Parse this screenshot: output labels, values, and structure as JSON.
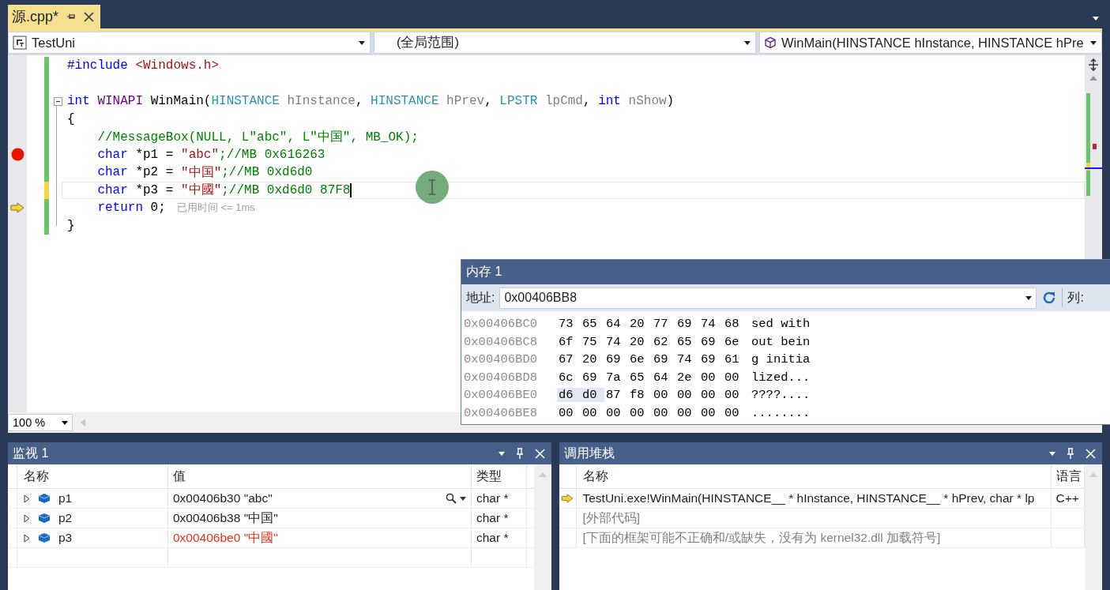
{
  "document_tabs": [
    {
      "label": "源.cpp*",
      "selected": true
    }
  ],
  "navigation_bar": [
    {
      "kind": "project",
      "text": "TestUni"
    },
    {
      "kind": "scope",
      "text": "(全局范围)"
    },
    {
      "kind": "function",
      "text": "WinMain(HINSTANCE hInstance, HINSTANCE hPre"
    }
  ],
  "editor": {
    "lines": [
      {
        "breakpoint": false,
        "current": false,
        "modified": false,
        "fold": false,
        "caret": false,
        "tokens": [
          {
            "kind": "keyword",
            "text": "#include"
          },
          {
            "kind": "string",
            "text": " <Windows.h>"
          }
        ]
      },
      {
        "breakpoint": false,
        "current": false,
        "modified": false,
        "fold": false,
        "caret": false
      },
      {
        "breakpoint": false,
        "current": false,
        "modified": false,
        "fold": true,
        "caret": false,
        "tokens": [
          {
            "kind": "keyword",
            "text": "int"
          },
          {
            "kind": "macro",
            "text": " WINAPI"
          },
          {
            "kind": "plain",
            "text": " WinMain("
          },
          {
            "kind": "type",
            "text": "HINSTANCE"
          },
          {
            "kind": "param",
            "text": " hInstance"
          },
          {
            "kind": "plain",
            "text": ", "
          },
          {
            "kind": "type",
            "text": "HINSTANCE"
          },
          {
            "kind": "param",
            "text": " hPrev"
          },
          {
            "kind": "plain",
            "text": ", "
          },
          {
            "kind": "type",
            "text": "LPSTR"
          },
          {
            "kind": "param",
            "text": " lpCmd"
          },
          {
            "kind": "plain",
            "text": ", "
          },
          {
            "kind": "keyword",
            "text": "int"
          },
          {
            "kind": "param",
            "text": " nShow"
          },
          {
            "kind": "plain",
            "text": ")"
          }
        ]
      },
      {
        "breakpoint": false,
        "current": false,
        "modified": false,
        "fold": false,
        "caret": false,
        "tokens": [
          {
            "kind": "plain",
            "text": "{"
          }
        ]
      },
      {
        "breakpoint": false,
        "current": false,
        "modified": false,
        "fold": false,
        "caret": false,
        "tokens": [
          {
            "kind": "comment",
            "text": "    //MessageBox(NULL, L\"abc\", L\"中国\", MB_OK);"
          }
        ]
      },
      {
        "breakpoint": true,
        "current": false,
        "modified": false,
        "fold": false,
        "caret": false,
        "tokens": [
          {
            "kind": "keyword",
            "text": "    char"
          },
          {
            "kind": "plain",
            "text": " *p1 = "
          },
          {
            "kind": "string",
            "text": "\"abc\""
          },
          {
            "kind": "comment",
            "text": ";//MB 0x616263"
          }
        ]
      },
      {
        "breakpoint": false,
        "current": false,
        "modified": false,
        "fold": false,
        "caret": false,
        "tokens": [
          {
            "kind": "keyword",
            "text": "    char"
          },
          {
            "kind": "plain",
            "text": " *p2 = "
          },
          {
            "kind": "string",
            "text": "\"中国\""
          },
          {
            "kind": "comment",
            "text": ";//MB 0xd6d0"
          }
        ]
      },
      {
        "breakpoint": false,
        "current": false,
        "modified": true,
        "fold": false,
        "caret": true,
        "tokens": [
          {
            "kind": "keyword",
            "text": "    char"
          },
          {
            "kind": "plain",
            "text": " *p3 = "
          },
          {
            "kind": "string",
            "text": "\"中國\""
          },
          {
            "kind": "comment",
            "text": ";//MB 0xd6d0 87F8"
          }
        ]
      },
      {
        "breakpoint": false,
        "current": true,
        "modified": false,
        "fold": false,
        "caret": false,
        "hint": "已用时间 <= 1ms",
        "tokens": [
          {
            "kind": "keyword",
            "text": "    return"
          },
          {
            "kind": "plain",
            "text": " 0;"
          }
        ]
      },
      {
        "breakpoint": false,
        "current": false,
        "modified": false,
        "fold": false,
        "caret": false,
        "tokens": [
          {
            "kind": "plain",
            "text": "}"
          }
        ]
      }
    ],
    "zoom": "100 %"
  },
  "memory_window": {
    "title": "内存 1",
    "address_label": "地址:",
    "address": "0x00406BB8",
    "columns_label": "列:",
    "rows": [
      {
        "address": "0x00406BC0",
        "ascii": "sed with",
        "bytes": [
          {
            "text": "73",
            "selected": false
          },
          {
            "text": "65",
            "selected": false
          },
          {
            "text": "64",
            "selected": false
          },
          {
            "text": "20",
            "selected": false
          },
          {
            "text": "77",
            "selected": false
          },
          {
            "text": "69",
            "selected": false
          },
          {
            "text": "74",
            "selected": false
          },
          {
            "text": "68",
            "selected": false
          }
        ]
      },
      {
        "address": "0x00406BC8",
        "ascii": "out bein",
        "bytes": [
          {
            "text": "6f",
            "selected": false
          },
          {
            "text": "75",
            "selected": false
          },
          {
            "text": "74",
            "selected": false
          },
          {
            "text": "20",
            "selected": false
          },
          {
            "text": "62",
            "selected": false
          },
          {
            "text": "65",
            "selected": false
          },
          {
            "text": "69",
            "selected": false
          },
          {
            "text": "6e",
            "selected": false
          }
        ]
      },
      {
        "address": "0x00406BD0",
        "ascii": "g initia",
        "bytes": [
          {
            "text": "67",
            "selected": false
          },
          {
            "text": "20",
            "selected": false
          },
          {
            "text": "69",
            "selected": false
          },
          {
            "text": "6e",
            "selected": false
          },
          {
            "text": "69",
            "selected": false
          },
          {
            "text": "74",
            "selected": false
          },
          {
            "text": "69",
            "selected": false
          },
          {
            "text": "61",
            "selected": false
          }
        ]
      },
      {
        "address": "0x00406BD8",
        "ascii": "lized...",
        "bytes": [
          {
            "text": "6c",
            "selected": false
          },
          {
            "text": "69",
            "selected": false
          },
          {
            "text": "7a",
            "selected": false
          },
          {
            "text": "65",
            "selected": false
          },
          {
            "text": "64",
            "selected": false
          },
          {
            "text": "2e",
            "selected": false
          },
          {
            "text": "00",
            "selected": false
          },
          {
            "text": "00",
            "selected": false
          }
        ]
      },
      {
        "address": "0x00406BE0",
        "ascii": "????....",
        "bytes": [
          {
            "text": "d6",
            "selected": true
          },
          {
            "text": "d0",
            "selected": true
          },
          {
            "text": "87",
            "selected": false
          },
          {
            "text": "f8",
            "selected": false
          },
          {
            "text": "00",
            "selected": false
          },
          {
            "text": "00",
            "selected": false
          },
          {
            "text": "00",
            "selected": false
          },
          {
            "text": "00",
            "selected": false
          }
        ]
      },
      {
        "address": "0x00406BE8",
        "ascii": "........",
        "bytes": [
          {
            "text": "00",
            "selected": false
          },
          {
            "text": "00",
            "selected": false
          },
          {
            "text": "00",
            "selected": false
          },
          {
            "text": "00",
            "selected": false
          },
          {
            "text": "00",
            "selected": false
          },
          {
            "text": "00",
            "selected": false
          },
          {
            "text": "00",
            "selected": false
          },
          {
            "text": "00",
            "selected": false
          }
        ]
      }
    ]
  },
  "watch_panel": {
    "title": "监视 1",
    "columns": [
      "名称",
      "值",
      "类型"
    ],
    "rows": [
      {
        "name": "p1",
        "value": "0x00406b30 \"abc\"",
        "type": "char *",
        "changed": false,
        "visualizer": true
      },
      {
        "name": "p2",
        "value": "0x00406b38 \"中国\"",
        "type": "char *",
        "changed": false,
        "visualizer": false
      },
      {
        "name": "p3",
        "value": "0x00406be0 \"中國\"",
        "type": "char *",
        "changed": true,
        "visualizer": false
      }
    ]
  },
  "call_stack_panel": {
    "title": "调用堆栈",
    "columns": [
      "名称",
      "语言"
    ],
    "rows": [
      {
        "name": "TestUni.exe!WinMain(HINSTANCE__ * hInstance, HINSTANCE__ * hPrev, char * lp",
        "language": "C++",
        "current": true,
        "external": false
      },
      {
        "name": "[外部代码]",
        "current": false,
        "external": true
      },
      {
        "name": "[下面的框架可能不正确和/或缺失，没有为 kernel32.dll 加载符号]",
        "current": false,
        "external": true
      }
    ]
  }
}
